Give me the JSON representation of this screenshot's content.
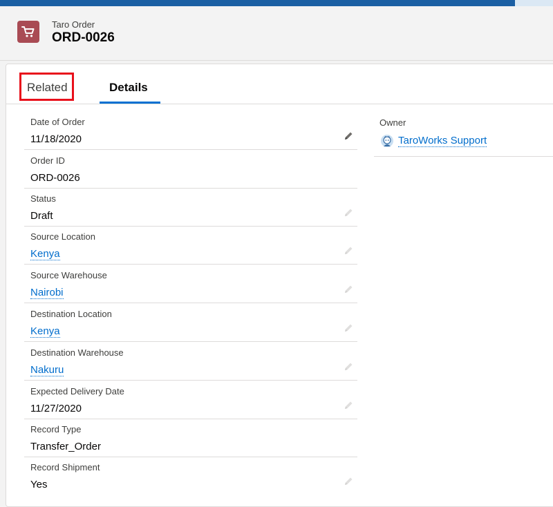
{
  "header": {
    "object_label": "Taro Order",
    "record_name": "ORD-0026",
    "icon": "cart-icon",
    "icon_color": "#a94b54"
  },
  "tabs": [
    {
      "label": "Related",
      "active": false,
      "highlighted": true
    },
    {
      "label": "Details",
      "active": true
    }
  ],
  "colors": {
    "accent": "#0070d2",
    "link": "#006dcc",
    "highlight_box": "#e8101b"
  },
  "fields": [
    {
      "label": "Date of Order",
      "value": "11/18/2020",
      "is_link": false,
      "editable": true
    },
    {
      "label": "Order ID",
      "value": "ORD-0026",
      "is_link": false,
      "editable": false
    },
    {
      "label": "Status",
      "value": "Draft",
      "is_link": false,
      "editable": true
    },
    {
      "label": "Source Location",
      "value": "Kenya",
      "is_link": true,
      "editable": true
    },
    {
      "label": "Source Warehouse",
      "value": "Nairobi",
      "is_link": true,
      "editable": true
    },
    {
      "label": "Destination Location",
      "value": "Kenya",
      "is_link": true,
      "editable": true
    },
    {
      "label": "Destination Warehouse",
      "value": "Nakuru",
      "is_link": true,
      "editable": true
    },
    {
      "label": "Expected Delivery Date",
      "value": "11/27/2020",
      "is_link": false,
      "editable": true
    },
    {
      "label": "Record Type",
      "value": "Transfer_Order",
      "is_link": false,
      "editable": false
    },
    {
      "label": "Record Shipment",
      "value": "Yes",
      "is_link": false,
      "editable": true
    }
  ],
  "owner": {
    "label": "Owner",
    "name": "TaroWorks Support",
    "avatar_icon": "user-avatar-icon"
  }
}
